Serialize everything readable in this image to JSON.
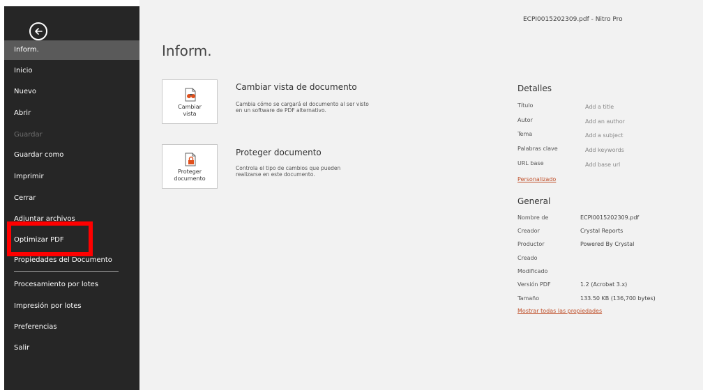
{
  "window": {
    "title": "ECPI0015202309.pdf - Nitro Pro"
  },
  "sidebar": {
    "back_icon": "back-arrow-icon",
    "items": [
      {
        "label": "Inform.",
        "active": true
      },
      {
        "label": "Inicio"
      },
      {
        "label": "Nuevo"
      },
      {
        "label": "Abrir"
      },
      {
        "label": "Guardar",
        "disabled": true
      },
      {
        "label": "Guardar como"
      },
      {
        "label": "Imprimir"
      },
      {
        "label": "Cerrar"
      },
      {
        "label": "Adjuntar archivos"
      },
      {
        "label": "Optimizar PDF"
      },
      {
        "label": "Propiedades del Documento"
      },
      {
        "label": "Procesamiento por lotes"
      },
      {
        "label": "Impresión por lotes"
      },
      {
        "label": "Preferencias"
      },
      {
        "label": "Salir"
      }
    ],
    "highlight_color": "#ff0000"
  },
  "main": {
    "title": "Inform.",
    "actions": [
      {
        "icon": "binoculars-document-icon",
        "tile_line1": "Cambiar",
        "tile_line2": "vista",
        "heading": "Cambiar vista de documento",
        "desc_line1": "Cambia cómo se cargará el documento al ser visto",
        "desc_line2": "en un software de PDF alternativo."
      },
      {
        "icon": "lock-document-icon",
        "tile_line1": "Proteger",
        "tile_line2": "documento",
        "heading": "Proteger documento",
        "desc_line1": "Controla el tipo de cambios que pueden",
        "desc_line2": "realizarse en este documento."
      }
    ]
  },
  "details": {
    "heading": "Detalles",
    "rows": [
      {
        "label": "Título",
        "value": "Add a title"
      },
      {
        "label": "Autor",
        "value": "Add an author"
      },
      {
        "label": "Tema",
        "value": "Add a subject"
      },
      {
        "label": "Palabras clave",
        "value": "Add keywords"
      },
      {
        "label": "URL base",
        "value": "Add base url"
      }
    ],
    "custom_link": "Personalizado"
  },
  "general": {
    "heading": "General",
    "rows": [
      {
        "label": "Nombre de",
        "value": "ECPI0015202309.pdf"
      },
      {
        "label": "Creador",
        "value": "Crystal Reports"
      },
      {
        "label": "Productor",
        "value": "Powered By Crystal"
      },
      {
        "label": "Creado",
        "value": ""
      },
      {
        "label": "Modificado",
        "value": ""
      },
      {
        "label": "Versión PDF",
        "value": "1.2 (Acrobat 3.x)"
      },
      {
        "label": "Tamaño",
        "value": "133.50 KB (136,700 bytes)"
      }
    ],
    "all_props_link": "Mostrar todas las propiedades"
  },
  "colors": {
    "sidebar_bg": "#262626",
    "active_item_bg": "#5a5a5a",
    "content_bg": "#f2f2f2",
    "link": "#c0502a",
    "lock_icon": "#e0501c"
  }
}
